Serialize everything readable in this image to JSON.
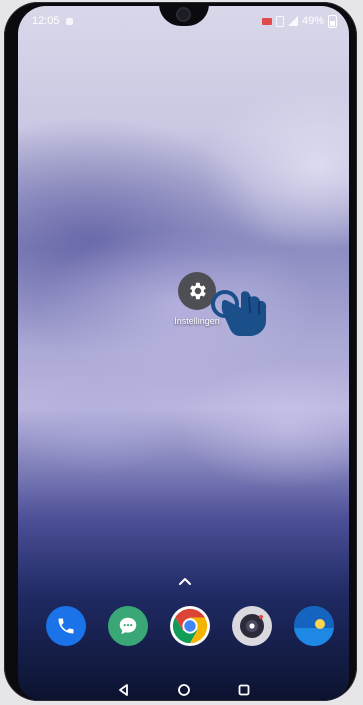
{
  "status_bar": {
    "time": "12:05",
    "battery": "49%"
  },
  "home": {
    "app_label": "Instellingen"
  },
  "dock": {
    "apps": [
      {
        "icon": "phone-icon",
        "color": "#1a73e8"
      },
      {
        "icon": "messages-icon",
        "color": "#3aa876"
      },
      {
        "icon": "chrome-icon",
        "color": "#db4437"
      },
      {
        "icon": "camera-icon",
        "color": "#d9d9de"
      },
      {
        "icon": "weather-icon",
        "color": "#1565c0"
      }
    ]
  },
  "navigation": {
    "buttons": [
      "back-icon",
      "home-icon",
      "recents-icon"
    ]
  },
  "colors": {
    "accent_hand": "#1b4f8a",
    "settings_bg": "#4e4e55"
  }
}
